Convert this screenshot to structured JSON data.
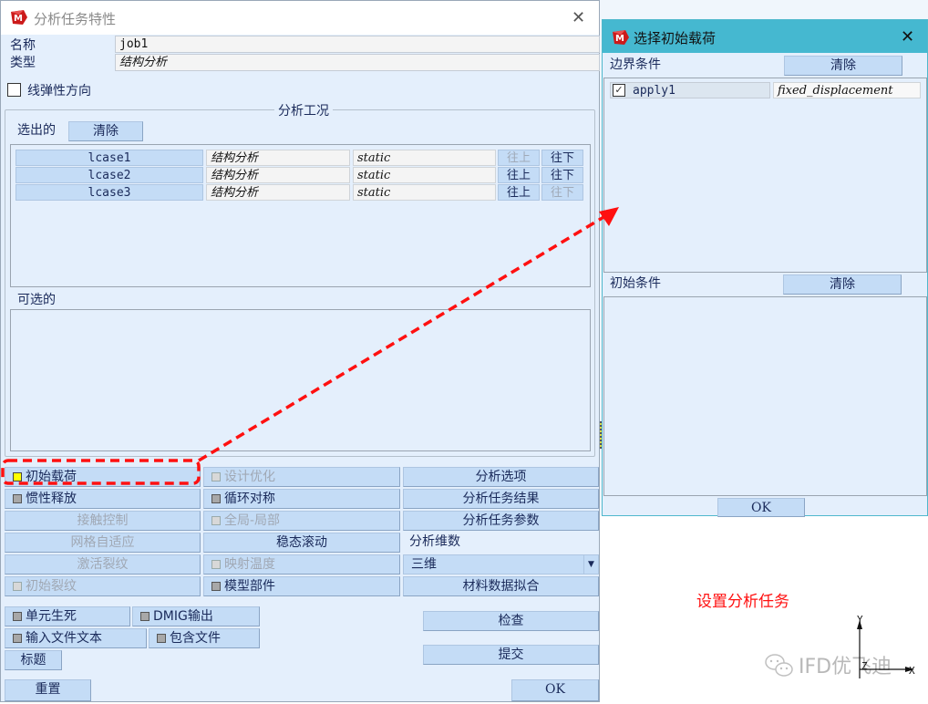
{
  "main_window": {
    "title": "分析任务特性",
    "close_icon": "close-icon",
    "name_label": "名称",
    "name_value": "job1",
    "type_label": "类型",
    "type_value": "结构分析",
    "linear_elastic_checkbox": {
      "label": "线弹性方向",
      "checked": false
    },
    "load_cases_group": {
      "title": "分析工况",
      "selected_label": "选出的",
      "clear_label": "清除",
      "selected_cases": [
        {
          "name": "lcase1",
          "type": "结构分析",
          "analysis": "static",
          "up": "往上",
          "down": "往下",
          "up_enabled": false,
          "down_enabled": true
        },
        {
          "name": "lcase2",
          "type": "结构分析",
          "analysis": "static",
          "up": "往上",
          "down": "往下",
          "up_enabled": true,
          "down_enabled": true
        },
        {
          "name": "lcase3",
          "type": "结构分析",
          "analysis": "static",
          "up": "往上",
          "down": "往下",
          "up_enabled": true,
          "down_enabled": false
        }
      ],
      "available_label": "可选的",
      "available_cases": []
    },
    "options_grid": {
      "col1": [
        {
          "label": "初始载荷",
          "indicator": "yellow",
          "enabled": true
        },
        {
          "label": "惯性释放",
          "indicator": "gray",
          "enabled": true
        },
        {
          "label": "接触控制",
          "indicator": "none",
          "enabled": false
        },
        {
          "label": "网格自适应",
          "indicator": "none",
          "enabled": false
        },
        {
          "label": "激活裂纹",
          "indicator": "none",
          "enabled": false
        },
        {
          "label": "初始裂纹",
          "indicator": "gray",
          "enabled": false
        }
      ],
      "col2": [
        {
          "label": "设计优化",
          "indicator": "gray",
          "enabled": false
        },
        {
          "label": "循环对称",
          "indicator": "gray",
          "enabled": true
        },
        {
          "label": "全局-局部",
          "indicator": "gray",
          "enabled": false
        },
        {
          "label": "稳态滚动",
          "indicator": "none",
          "enabled": true
        },
        {
          "label": "映射温度",
          "indicator": "gray",
          "enabled": false
        },
        {
          "label": "模型部件",
          "indicator": "gray",
          "enabled": true
        }
      ],
      "col3": {
        "analysis_options": "分析选项",
        "job_results": "分析任务结果",
        "job_parameters": "分析任务参数",
        "dimension_label": "分析维数",
        "dimension_value": "三维",
        "material_fitting": "材料数据拟合"
      }
    },
    "bottom": {
      "element_death": "单元生死",
      "dmig_output": "DMIG输出",
      "input_file_text": "输入文件文本",
      "include_file": "包含文件",
      "title": "标题",
      "check": "检查",
      "submit": "提交",
      "reset": "重置",
      "ok": "OK"
    }
  },
  "initial_loads_window": {
    "title": "选择初始载荷",
    "boundary_label": "边界条件",
    "clear_label": "清除",
    "boundary_conditions": [
      {
        "name": "apply1",
        "type": "fixed_displacement",
        "checked": true
      }
    ],
    "initial_label": "初始条件",
    "initial_clear_label": "清除",
    "initial_conditions": [],
    "ok": "OK"
  },
  "annotation": {
    "caption": "设置分析任务",
    "color": "#ff1010"
  },
  "watermark": {
    "text": "IFD优飞迪",
    "icon": "wechat-icon"
  },
  "axis_triad": {
    "x": "X",
    "y": "Y",
    "z": "Z"
  }
}
